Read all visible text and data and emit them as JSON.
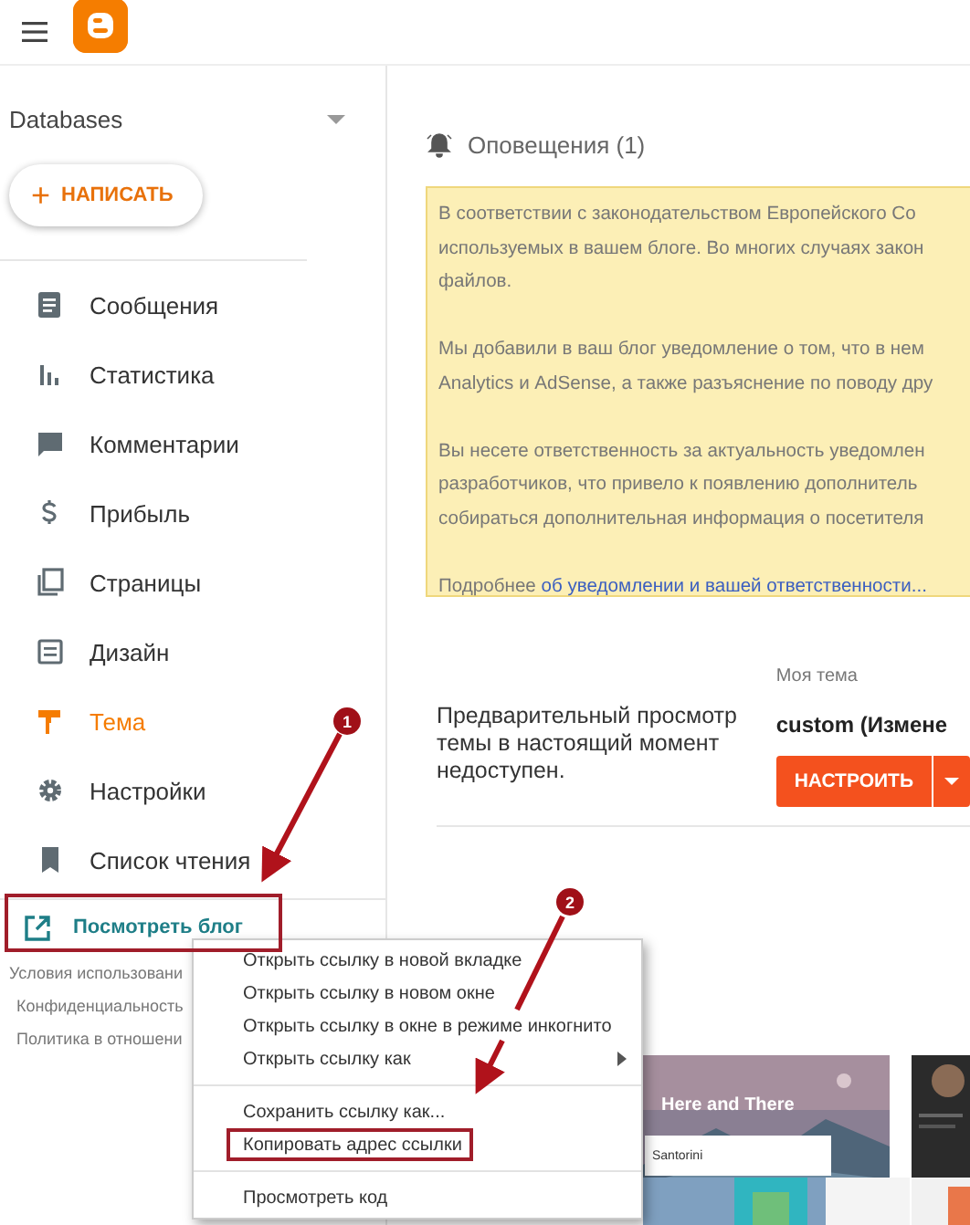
{
  "blog_selector": {
    "name": "Databases"
  },
  "compose_button": {
    "icon": "+",
    "label": "НАПИСАТЬ"
  },
  "nav": [
    {
      "kind": "posts",
      "label": "Сообщения",
      "selected": false
    },
    {
      "kind": "stats",
      "label": "Статистика",
      "selected": false
    },
    {
      "kind": "comments",
      "label": "Комментарии",
      "selected": false
    },
    {
      "kind": "earnings",
      "label": "Прибыль",
      "selected": false
    },
    {
      "kind": "pages",
      "label": "Страницы",
      "selected": false
    },
    {
      "kind": "layout",
      "label": "Дизайн",
      "selected": false
    },
    {
      "kind": "theme",
      "label": "Тема",
      "selected": true
    },
    {
      "kind": "settings",
      "label": "Настройки",
      "selected": false
    },
    {
      "kind": "reading",
      "label": "Список чтения",
      "selected": false
    }
  ],
  "view_blog": {
    "label": "Посмотреть блог"
  },
  "footer_links": [
    "Условия использовани",
    "Конфиденциальность",
    "Политика в отношени"
  ],
  "notifications": {
    "title": "Оповещения (1)",
    "paragraphs": [
      [
        "В соответствии с законодательством Европейского Со",
        "используемых в вашем блоге. Во многих случаях закон",
        "файлов."
      ],
      [
        "Мы добавили в ваш блог уведомление о том, что в нем",
        "Analytics и AdSense, а также разъяснение по поводу дру"
      ],
      [
        "Вы несете ответственность за актуальность уведомлен",
        "разработчиков, что привело к появлению дополнитель",
        "собираться дополнительная информация о посетителя"
      ]
    ],
    "more_prefix": "Подробнее",
    "more_link": "об уведомлении и вашей ответственности..."
  },
  "theme": {
    "preview_note": "Предварительный просмотр темы в настоящий момент недоступен.",
    "my_theme_label": "Моя тема",
    "current": "custom (Измене",
    "customize_button": "НАСТРОИТЬ"
  },
  "theme_gallery": [
    {
      "title": "Here and There",
      "card": "Santorini"
    }
  ],
  "context_menu": {
    "groups": [
      [
        {
          "label": "Открыть ссылку в новой вкладке",
          "submenu": false,
          "highlighted": false
        },
        {
          "label": "Открыть ссылку в новом окне",
          "submenu": false,
          "highlighted": false
        },
        {
          "label": "Открыть ссылку в окне в режиме инкогнито",
          "submenu": false,
          "highlighted": false
        },
        {
          "label": "Открыть ссылку как",
          "submenu": true,
          "highlighted": false
        }
      ],
      [
        {
          "label": "Сохранить ссылку как...",
          "submenu": false,
          "highlighted": false
        },
        {
          "label": "Копировать адрес ссылки",
          "submenu": false,
          "highlighted": true
        }
      ],
      [
        {
          "label": "Просмотреть код",
          "submenu": false,
          "highlighted": false
        }
      ]
    ]
  },
  "annotations": [
    {
      "number": "1"
    },
    {
      "number": "2"
    }
  ]
}
